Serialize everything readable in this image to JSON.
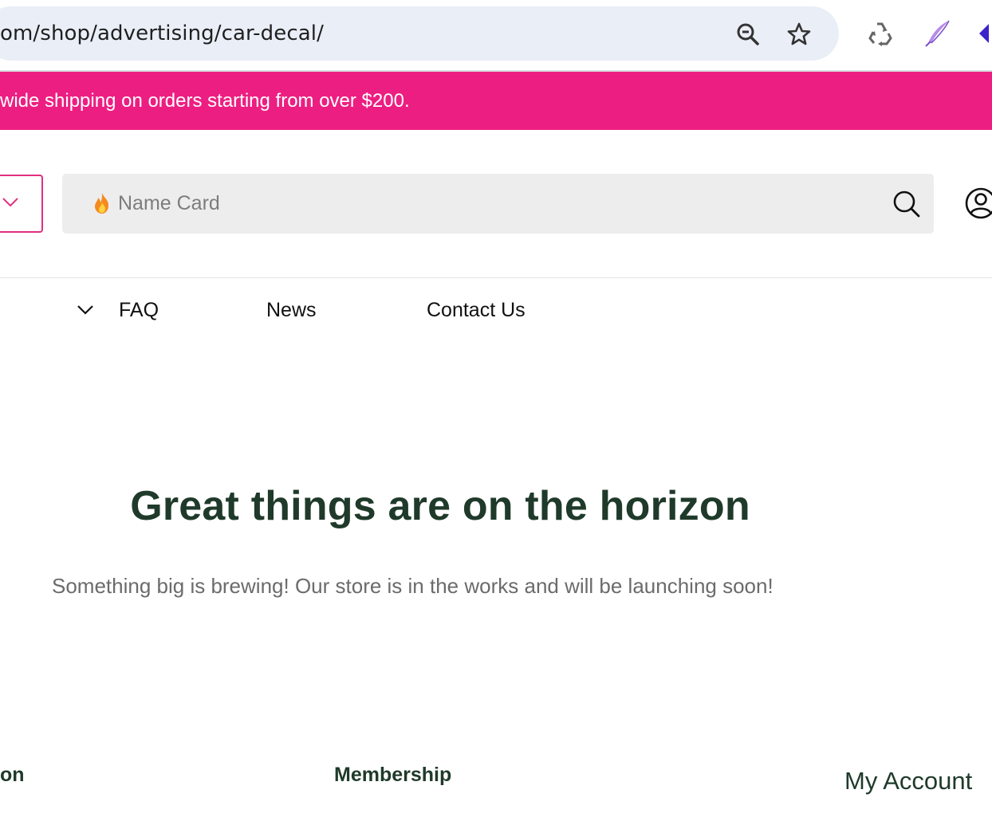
{
  "browser": {
    "url": "om/shop/advertising/car-decal/",
    "icons": [
      "zoom-out-icon",
      "star-icon",
      "recycle-extension-icon",
      "quill-extension-icon",
      "extension-icon"
    ]
  },
  "announcement": {
    "text": "wide shipping on orders starting from over $200."
  },
  "header": {
    "search_placeholder": "Name Card"
  },
  "nav": {
    "items": [
      "FAQ",
      "News",
      "Contact Us"
    ]
  },
  "main": {
    "headline": "Great things are on the horizon",
    "subtext": "Something big is brewing! Our store is in the works and will be launching soon!"
  },
  "footer": {
    "col1": "on",
    "col2": "Membership",
    "col3": "My Account"
  },
  "colors": {
    "accent": "#ed1e82",
    "heading": "#1f3a2a",
    "search_bg": "#ededed"
  }
}
